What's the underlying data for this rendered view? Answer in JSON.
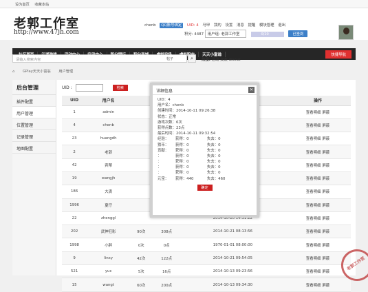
{
  "topbar": {
    "set_home": "设为首页",
    "bookmark": "收藏本站"
  },
  "logo": {
    "name": "老郭工作室",
    "url": "http://www.47jh.com"
  },
  "user": {
    "name": "chenb",
    "qq_bind": "QQ账号绑定",
    "uid_label": "UID: 4",
    "links": [
      "马甲",
      "我的",
      "设置",
      "消息",
      "提醒",
      "模块管理",
      "退出"
    ],
    "points_label": "积分: 4487",
    "group_label": "用户组: 老郭工作室",
    "progress_text": "0/20",
    "progress_fraction": 0.0,
    "signed_label": "已签到"
  },
  "nav": {
    "items": [
      "社区首页",
      "江湖游戏",
      "活动中心",
      "应用中心",
      "积分银行",
      "积分商城",
      "虚拟农场",
      "虚拟股市",
      "天天小富翁"
    ],
    "quick_label": "快捷导航"
  },
  "search": {
    "placeholder": "请输入搜索内容",
    "category": "帖子",
    "hot_label": "热搜:",
    "hot_terms": "活动 交友 discuz"
  },
  "breadcrumb": [
    "GPlay天天小富翁",
    "用户管理"
  ],
  "sidebar": {
    "title": "后台管理",
    "items": [
      "插件配置",
      "用户管理",
      "位置管理",
      "记录管理",
      "地图配置"
    ]
  },
  "filter": {
    "uid_label": "UID :",
    "search_button": "检索"
  },
  "table": {
    "headers": [
      "UID",
      "用户名",
      "",
      "",
      "最后时间",
      "操作"
    ],
    "op_view": "查看明细",
    "op_block": "屏蔽",
    "rows": [
      {
        "uid": "1",
        "name": "admin",
        "c3": "",
        "c4": "",
        "time": "2014-10-15 00:56:03"
      },
      {
        "uid": "4",
        "name": "chenb",
        "c3": "",
        "c4": "",
        "time": "2014-10-11 09:32:54"
      },
      {
        "uid": "23",
        "name": "huangdh",
        "c3": "",
        "c4": "",
        "time": "2014-10-11 09:26:50"
      },
      {
        "uid": "2",
        "name": "老郭",
        "c3": "",
        "c4": "",
        "time": "2014-10-19 22:47:15"
      },
      {
        "uid": "42",
        "name": "宾蒂",
        "c3": "",
        "c4": "",
        "time": "2014-10-15 11:11:48"
      },
      {
        "uid": "19",
        "name": "wangjh",
        "c3": "",
        "c4": "",
        "time": "2014-10-11 18:42:31"
      },
      {
        "uid": "186",
        "name": "大滴",
        "c3": "",
        "c4": "",
        "time": "2014-10-21 08:35:34"
      },
      {
        "uid": "1996",
        "name": "夏仔",
        "c3": "",
        "c4": "",
        "time": "1970-01-01 08:00:00"
      },
      {
        "uid": "22",
        "name": "zhenggl",
        "c3": "",
        "c4": "",
        "time": "2014-10-20 14:31:22"
      },
      {
        "uid": "202",
        "name": "武神狂影",
        "c3": "90次",
        "c4": "308点",
        "time": "2014-10-21 08:13:56"
      },
      {
        "uid": "1998",
        "name": "小胖",
        "c3": "0次",
        "c4": "0点",
        "time": "1970-01-01 08:00:00"
      },
      {
        "uid": "9",
        "name": "linxy",
        "c3": "42次",
        "c4": "122点",
        "time": "2014-10-21 09:54:05"
      },
      {
        "uid": "521",
        "name": "yuc",
        "c3": "5次",
        "c4": "16点",
        "time": "2014-10-13 09:23:56"
      },
      {
        "uid": "15",
        "name": "wangt",
        "c3": "60次",
        "c4": "200点",
        "time": "2014-10-13 09:34:30"
      }
    ]
  },
  "dialog": {
    "title": "详细信息",
    "fields": [
      {
        "k": "UID：",
        "v": "4"
      },
      {
        "k": "用户名：",
        "v": "chenb"
      },
      {
        "k": "创建时间：",
        "v": "2014-10-11 09:26:38"
      },
      {
        "k": "状态：",
        "v": "正常"
      },
      {
        "k": "游戏次数：",
        "v": "6次"
      },
      {
        "k": "获得点数：",
        "v": "23点"
      },
      {
        "k": "最后时间：",
        "v": "2014-10-11 09:32:54"
      }
    ],
    "stats": [
      {
        "k": "经验：",
        "a": "获得：0",
        "b": "失去：0"
      },
      {
        "k": "猜币：",
        "a": "获得：0",
        "b": "失去：0"
      },
      {
        "k": "贡献：",
        "a": "获得：0",
        "b": "失去：0"
      },
      {
        "k": "：",
        "a": "获得：0",
        "b": "失去：0"
      },
      {
        "k": "：",
        "a": "获得：0",
        "b": "失去：0"
      },
      {
        "k": "：",
        "a": "获得：0",
        "b": "失去：0"
      },
      {
        "k": "：",
        "a": "获得：0",
        "b": "失去：0"
      },
      {
        "k": "元宝：",
        "a": "获得：440",
        "b": "失去：460"
      }
    ],
    "ok_label": "确定"
  },
  "stamp": "老郭工作室"
}
